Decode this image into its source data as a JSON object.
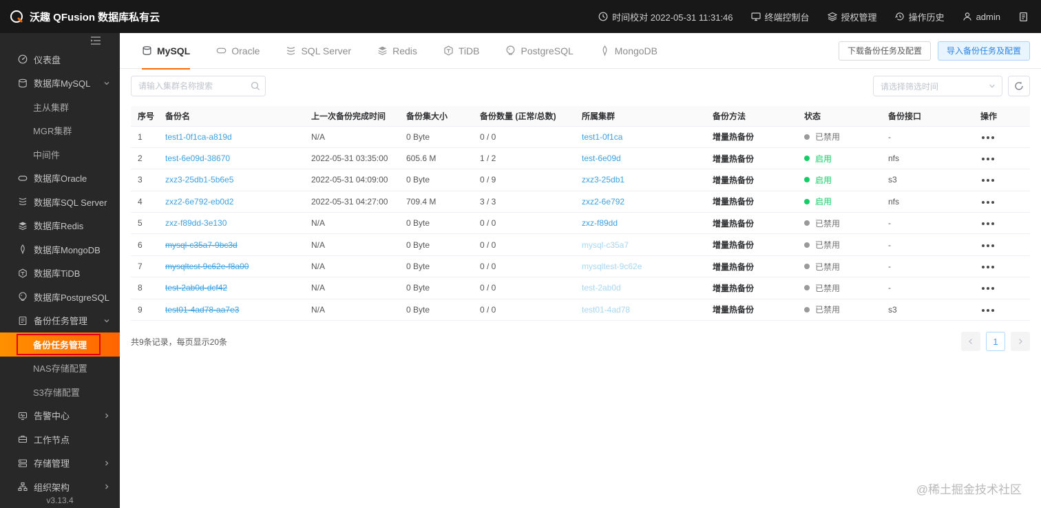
{
  "topbar": {
    "app_title": "沃趣 QFusion 数据库私有云",
    "time_sync": "时间校对 2022-05-31 11:31:46",
    "console": "终端控制台",
    "license": "授权管理",
    "history": "操作历史",
    "user": "admin"
  },
  "sidebar": {
    "version": "v3.13.4",
    "items": [
      {
        "label": "仪表盘"
      },
      {
        "label": "数据库MySQL"
      },
      {
        "label": "主从集群"
      },
      {
        "label": "MGR集群"
      },
      {
        "label": "中间件"
      },
      {
        "label": "数据库Oracle"
      },
      {
        "label": "数据库SQL Server"
      },
      {
        "label": "数据库Redis"
      },
      {
        "label": "数据库MongoDB"
      },
      {
        "label": "数据库TiDB"
      },
      {
        "label": "数据库PostgreSQL"
      },
      {
        "label": "备份任务管理"
      },
      {
        "label": "备份任务管理"
      },
      {
        "label": "NAS存储配置"
      },
      {
        "label": "S3存储配置"
      },
      {
        "label": "告警中心"
      },
      {
        "label": "工作节点"
      },
      {
        "label": "存储管理"
      },
      {
        "label": "组织架构"
      }
    ]
  },
  "tabs": [
    {
      "label": "MySQL"
    },
    {
      "label": "Oracle"
    },
    {
      "label": "SQL Server"
    },
    {
      "label": "Redis"
    },
    {
      "label": "TiDB"
    },
    {
      "label": "PostgreSQL"
    },
    {
      "label": "MongoDB"
    }
  ],
  "actions": {
    "download": "下载备份任务及配置",
    "import": "导入备份任务及配置"
  },
  "toolbar": {
    "search_placeholder": "请输入集群名称搜索",
    "filter_placeholder": "请选择筛选时间"
  },
  "table": {
    "columns": [
      "序号",
      "备份名",
      "上一次备份完成时间",
      "备份集大小",
      "备份数量 (正常/总数)",
      "所属集群",
      "备份方法",
      "状态",
      "备份接口",
      "操作"
    ],
    "rows": [
      {
        "num": "1",
        "name": "test1-0f1ca-a819d",
        "last": "N/A",
        "size": "0 Byte",
        "count": "0 / 0",
        "cluster": "test1-0f1ca",
        "method": "增量热备份",
        "status": "已禁用",
        "iface": "-"
      },
      {
        "num": "2",
        "name": "test-6e09d-38670",
        "last": "2022-05-31 03:35:00",
        "size": "605.6 M",
        "count": "1 / 2",
        "cluster": "test-6e09d",
        "method": "增量热备份",
        "status": "启用",
        "iface": "nfs"
      },
      {
        "num": "3",
        "name": "zxz3-25db1-5b6e5",
        "last": "2022-05-31 04:09:00",
        "size": "0 Byte",
        "count": "0 / 9",
        "cluster": "zxz3-25db1",
        "method": "增量热备份",
        "status": "启用",
        "iface": "s3"
      },
      {
        "num": "4",
        "name": "zxz2-6e792-eb0d2",
        "last": "2022-05-31 04:27:00",
        "size": "709.4 M",
        "count": "3 / 3",
        "cluster": "zxz2-6e792",
        "method": "增量热备份",
        "status": "启用",
        "iface": "nfs"
      },
      {
        "num": "5",
        "name": "zxz-f89dd-3e130",
        "last": "N/A",
        "size": "0 Byte",
        "count": "0 / 0",
        "cluster": "zxz-f89dd",
        "method": "增量热备份",
        "status": "已禁用",
        "iface": "-"
      },
      {
        "num": "6",
        "name": "mysql-c35a7-9bc3d",
        "last": "N/A",
        "size": "0 Byte",
        "count": "0 / 0",
        "cluster": "mysql-c35a7",
        "method": "增量热备份",
        "status": "已禁用",
        "iface": "-"
      },
      {
        "num": "7",
        "name": "mysqltest-9c62e-f8a00",
        "last": "N/A",
        "size": "0 Byte",
        "count": "0 / 0",
        "cluster": "mysqltest-9c62e",
        "method": "增量热备份",
        "status": "已禁用",
        "iface": "-"
      },
      {
        "num": "8",
        "name": "test-2ab0d-dcf42",
        "last": "N/A",
        "size": "0 Byte",
        "count": "0 / 0",
        "cluster": "test-2ab0d",
        "method": "增量热备份",
        "status": "已禁用",
        "iface": "-"
      },
      {
        "num": "9",
        "name": "test01-4ad78-aa7e3",
        "last": "N/A",
        "size": "0 Byte",
        "count": "0 / 0",
        "cluster": "test01-4ad78",
        "method": "增量热备份",
        "status": "已禁用",
        "iface": "s3"
      }
    ]
  },
  "footer": {
    "total": "共9条记录，每页显示20条",
    "page": "1"
  },
  "watermark": "@稀土掘金技术社区",
  "colors": {
    "accent": "#ff6a00",
    "link": "#3ba1e3",
    "enabled": "#13ce66",
    "disabled": "#9a9a9a"
  }
}
